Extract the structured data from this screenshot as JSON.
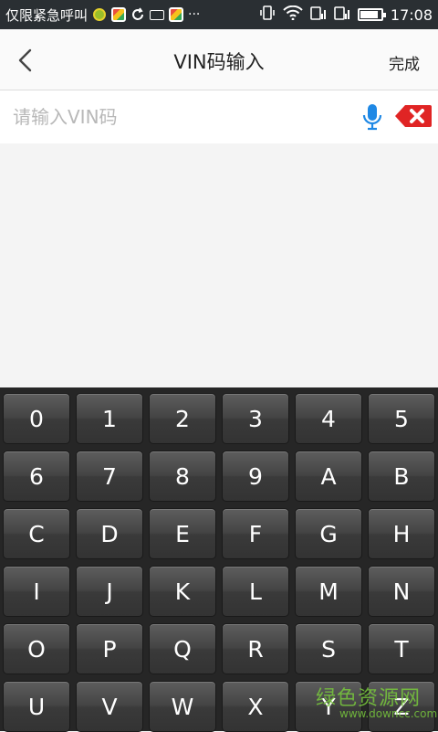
{
  "status_bar": {
    "carrier": "仅限紧急呼叫",
    "more": "···",
    "time": "17:08",
    "battery_level": 0.8
  },
  "header": {
    "title": "VIN码输入",
    "done_label": "完成"
  },
  "vin_input": {
    "value": "",
    "placeholder": "请输入VIN码"
  },
  "keyboard": {
    "keys": [
      "0",
      "1",
      "2",
      "3",
      "4",
      "5",
      "6",
      "7",
      "8",
      "9",
      "A",
      "B",
      "C",
      "D",
      "E",
      "F",
      "G",
      "H",
      "I",
      "J",
      "K",
      "L",
      "M",
      "N",
      "O",
      "P",
      "Q",
      "R",
      "S",
      "T",
      "U",
      "V",
      "W",
      "X",
      "Y",
      "Z"
    ]
  },
  "watermark": {
    "text": "绿色资源网",
    "url": "www.downcc.com"
  },
  "colors": {
    "accent_blue": "#1e88e5",
    "clear_red": "#e02424",
    "keyboard_bg": "#262626"
  },
  "icons": [
    "back-arrow-icon",
    "microphone-icon",
    "clear-icon",
    "signal-icon",
    "wifi-icon",
    "battery-icon"
  ]
}
